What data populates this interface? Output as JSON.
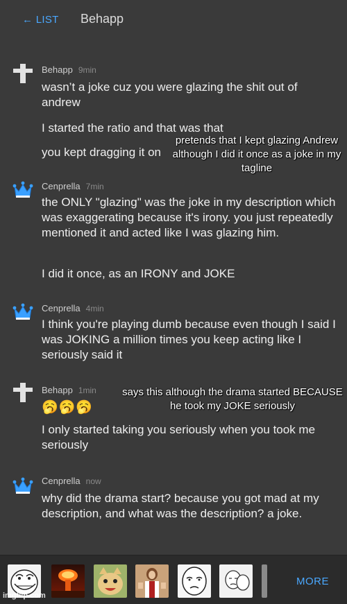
{
  "header": {
    "back_label": "← LIST",
    "title": "Behapp"
  },
  "comments": [
    {
      "user": "Behapp",
      "time": "9min",
      "avatar": "cross-icon",
      "paragraphs": [
        "wasn’t a joke cuz you were glazing the shit out of andrew",
        "I started the ratio and that was that",
        "you kept dragging it on"
      ]
    },
    {
      "user": "Cenprella",
      "time": "7min",
      "avatar": "crown-icon",
      "paragraphs": [
        "the ONLY \"glazing\" was the joke in my description which was exaggerating because it's irony. you just repeatedly mentioned it and acted like I was glazing him.",
        "I did it once, as an IRONY and JOKE"
      ]
    },
    {
      "user": "Cenprella",
      "time": "4min",
      "avatar": "crown-icon",
      "paragraphs": [
        "I think you're playing dumb because even though I said I was JOKING a million times you keep acting like I seriously said it"
      ]
    },
    {
      "user": "Behapp",
      "time": "1min",
      "avatar": "cross-icon",
      "paragraphs": [
        "🥱🥱🥱",
        "I only started taking you seriously when you took me seriously"
      ]
    },
    {
      "user": "Cenprella",
      "time": "now",
      "avatar": "crown-icon",
      "paragraphs": [
        "why did the drama start? because you got mad at my description, and what was the description? a joke."
      ]
    }
  ],
  "overlays": [
    "pretends that I kept glazing Andrew although I did it once as a joke in my tagline",
    "says this although the drama started BECAUSE he took my JOKE seriously"
  ],
  "footer": {
    "more_label": "MORE",
    "thumbnails": [
      "trollface-meme",
      "nuclear-explosion-meme",
      "cat-meme",
      "jesus-thumbs-up-meme",
      "okay-face-meme",
      "wojak-meme",
      "partial-meme"
    ]
  },
  "watermark": "imgflip.com",
  "colors": {
    "background": "#3a3a3a",
    "accent": "#4aa8ff",
    "crown": "#3aa0ff"
  }
}
